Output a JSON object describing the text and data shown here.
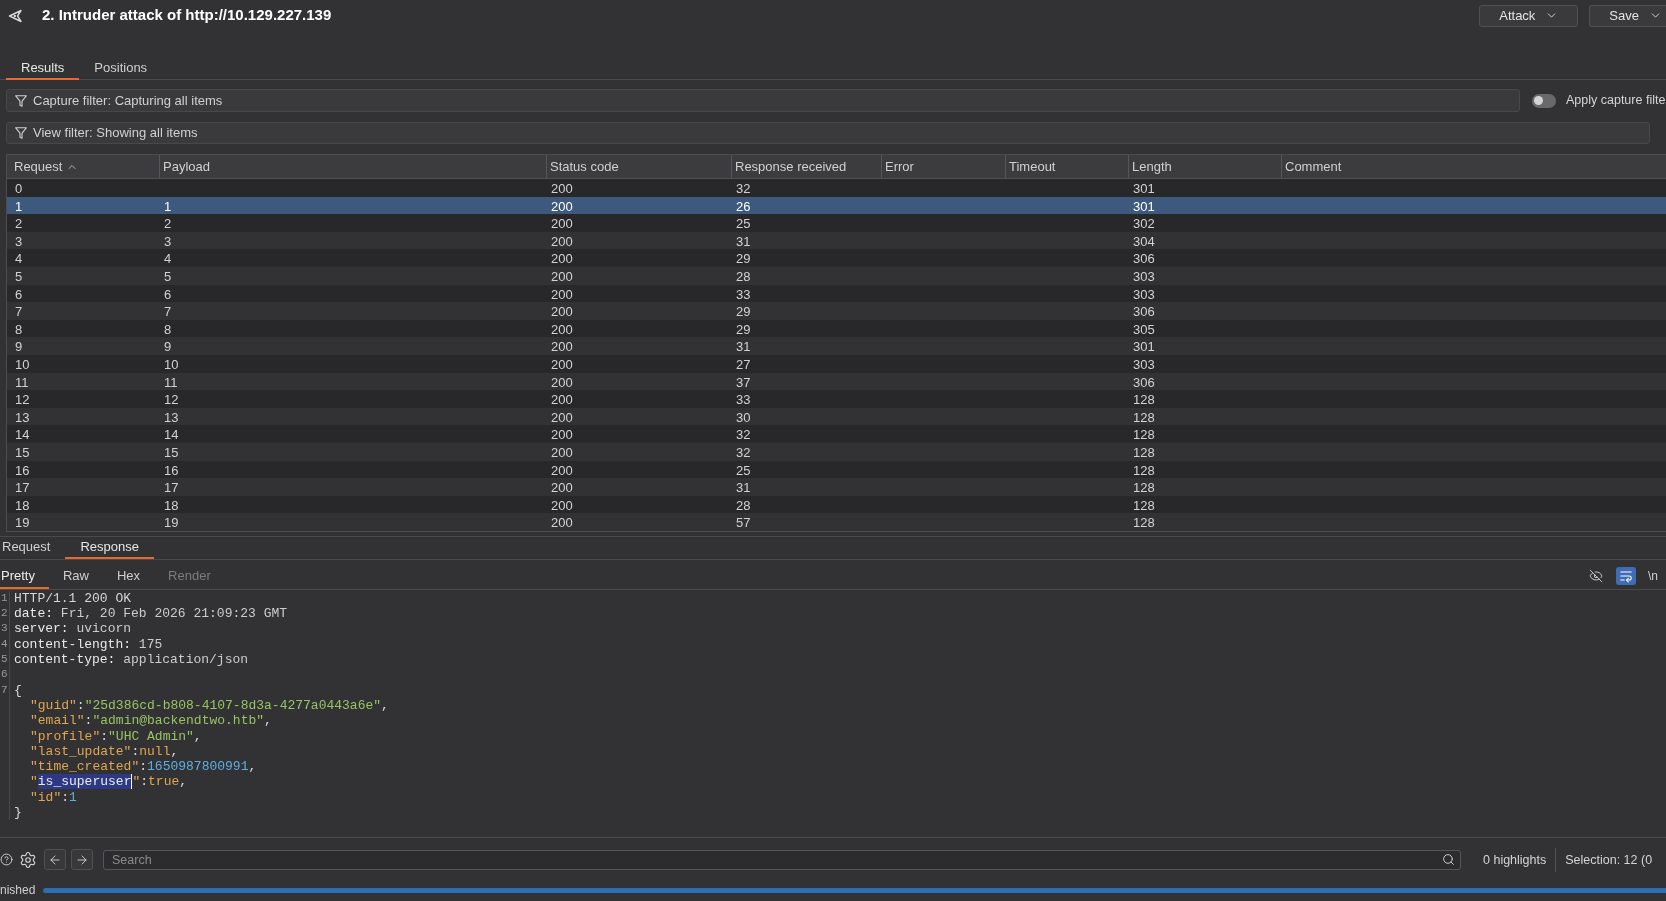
{
  "header": {
    "title": "2. Intruder attack of http://10.129.227.139",
    "buttons": [
      {
        "label": "Attack"
      },
      {
        "label": "Save"
      }
    ]
  },
  "tabs": [
    {
      "label": "Results",
      "selected": true
    },
    {
      "label": "Positions",
      "selected": false
    }
  ],
  "capture_filter": {
    "label": "Capture filter: Capturing all items",
    "toggle": {
      "label": "Apply capture filte",
      "on": false
    }
  },
  "view_filter": {
    "label": "View filter: Showing all items"
  },
  "table": {
    "columns": [
      {
        "label": "Request",
        "sorted_ascending": true
      },
      {
        "label": "Payload",
        "sorted_ascending": false
      },
      {
        "label": "Status code",
        "sorted_ascending": false
      },
      {
        "label": "Response received",
        "sorted_ascending": false
      },
      {
        "label": "Error",
        "sorted_ascending": false
      },
      {
        "label": "Timeout",
        "sorted_ascending": false
      },
      {
        "label": "Length",
        "sorted_ascending": false
      },
      {
        "label": "Comment",
        "sorted_ascending": false
      }
    ],
    "rows": [
      {
        "request": "0",
        "status_code": "200",
        "response_received": "32",
        "length": "301",
        "selected": false
      },
      {
        "request": "1",
        "payload": "1",
        "status_code": "200",
        "response_received": "26",
        "length": "301",
        "selected": true
      },
      {
        "request": "2",
        "payload": "2",
        "status_code": "200",
        "response_received": "25",
        "length": "302",
        "selected": false
      },
      {
        "request": "3",
        "payload": "3",
        "status_code": "200",
        "response_received": "31",
        "length": "304",
        "selected": false
      },
      {
        "request": "4",
        "payload": "4",
        "status_code": "200",
        "response_received": "29",
        "length": "306",
        "selected": false
      },
      {
        "request": "5",
        "payload": "5",
        "status_code": "200",
        "response_received": "28",
        "length": "303",
        "selected": false
      },
      {
        "request": "6",
        "payload": "6",
        "status_code": "200",
        "response_received": "33",
        "length": "303",
        "selected": false
      },
      {
        "request": "7",
        "payload": "7",
        "status_code": "200",
        "response_received": "29",
        "length": "306",
        "selected": false
      },
      {
        "request": "8",
        "payload": "8",
        "status_code": "200",
        "response_received": "29",
        "length": "305",
        "selected": false
      },
      {
        "request": "9",
        "payload": "9",
        "status_code": "200",
        "response_received": "31",
        "length": "301",
        "selected": false
      },
      {
        "request": "10",
        "payload": "10",
        "status_code": "200",
        "response_received": "27",
        "length": "303",
        "selected": false
      },
      {
        "request": "11",
        "payload": "11",
        "status_code": "200",
        "response_received": "37",
        "length": "306",
        "selected": false
      },
      {
        "request": "12",
        "payload": "12",
        "status_code": "200",
        "response_received": "33",
        "length": "128",
        "selected": false
      },
      {
        "request": "13",
        "payload": "13",
        "status_code": "200",
        "response_received": "30",
        "length": "128",
        "selected": false
      },
      {
        "request": "14",
        "payload": "14",
        "status_code": "200",
        "response_received": "32",
        "length": "128",
        "selected": false
      },
      {
        "request": "15",
        "payload": "15",
        "status_code": "200",
        "response_received": "32",
        "length": "128",
        "selected": false
      },
      {
        "request": "16",
        "payload": "16",
        "status_code": "200",
        "response_received": "25",
        "length": "128",
        "selected": false
      },
      {
        "request": "17",
        "payload": "17",
        "status_code": "200",
        "response_received": "31",
        "length": "128",
        "selected": false
      },
      {
        "request": "18",
        "payload": "18",
        "status_code": "200",
        "response_received": "28",
        "length": "128",
        "selected": false
      },
      {
        "request": "19",
        "payload": "19",
        "status_code": "200",
        "response_received": "57",
        "length": "128",
        "selected": false
      }
    ]
  },
  "message_tabs": [
    {
      "label": "Request",
      "selected": false
    },
    {
      "label": "Response",
      "selected": true
    }
  ],
  "view_tabs": [
    {
      "label": "Pretty",
      "selected": true,
      "disabled": false
    },
    {
      "label": "Raw",
      "selected": false,
      "disabled": false
    },
    {
      "label": "Hex",
      "selected": false,
      "disabled": false
    },
    {
      "label": "Render",
      "selected": false,
      "disabled": true
    }
  ],
  "view_tools": [
    {
      "kind": "hide",
      "on": false
    },
    {
      "kind": "wrap",
      "on": true
    },
    {
      "kind": "newline",
      "label": "\\n",
      "on": false
    }
  ],
  "code_lines": [
    {
      "number": "1",
      "tokens": [
        {
          "text": "HTTP/1.1 200 OK",
          "kind": "plain"
        }
      ]
    },
    {
      "number": "2",
      "tokens": [
        {
          "text": "date:",
          "kind": "header_name"
        },
        {
          "text": "Fri, 20 Feb 2026 21:09:23 GMT",
          "kind": "header_value"
        }
      ]
    },
    {
      "number": "3",
      "tokens": [
        {
          "text": "server:",
          "kind": "header_name"
        },
        {
          "text": "uvicorn",
          "kind": "header_value"
        }
      ]
    },
    {
      "number": "4",
      "tokens": [
        {
          "text": "content-length:",
          "kind": "header_name"
        },
        {
          "text": "175",
          "kind": "header_value"
        }
      ]
    },
    {
      "number": "5",
      "tokens": [
        {
          "text": "content-type:",
          "kind": "header_name"
        },
        {
          "text": "application/json",
          "kind": "header_value"
        }
      ]
    },
    {
      "number": "6"
    },
    {
      "number": "7",
      "tokens": [
        {
          "text": "{",
          "kind": "punct"
        }
      ],
      "children": [
        {
          "tokens": [
            {
              "text": "\"guid\"",
              "kind": "key"
            },
            {
              "text": ":",
              "kind": "punct"
            },
            {
              "text": "\"25d386cd-b808-4107-8d3a-4277a0443a6e\"",
              "kind": "string"
            },
            {
              "text": ",",
              "kind": "punct"
            }
          ]
        },
        {
          "tokens": [
            {
              "text": "\"email\"",
              "kind": "key"
            },
            {
              "text": ":",
              "kind": "punct"
            },
            {
              "text": "\"admin@backendtwo.htb\"",
              "kind": "string"
            },
            {
              "text": ",",
              "kind": "punct"
            }
          ]
        },
        {
          "tokens": [
            {
              "text": "\"profile\"",
              "kind": "key"
            },
            {
              "text": ":",
              "kind": "punct"
            },
            {
              "text": "\"UHC Admin\"",
              "kind": "string"
            },
            {
              "text": ",",
              "kind": "punct"
            }
          ]
        },
        {
          "tokens": [
            {
              "text": "\"last_update\"",
              "kind": "key"
            },
            {
              "text": ":",
              "kind": "punct"
            },
            {
              "text": "null",
              "kind": "literal"
            },
            {
              "text": ",",
              "kind": "punct"
            }
          ]
        },
        {
          "tokens": [
            {
              "text": "\"time_created\"",
              "kind": "key"
            },
            {
              "text": ":",
              "kind": "punct"
            },
            {
              "text": "1650987800991",
              "kind": "number"
            },
            {
              "text": ",",
              "kind": "punct"
            }
          ]
        },
        {
          "tokens": [
            {
              "text": "\"",
              "kind": "key"
            },
            {
              "text": "is_superuser",
              "kind": "selection"
            },
            {
              "text": "\"",
              "kind": "key"
            },
            {
              "text": ":",
              "kind": "punct"
            },
            {
              "text": "true",
              "kind": "literal"
            },
            {
              "text": ",",
              "kind": "punct"
            }
          ]
        },
        {
          "tokens": [
            {
              "text": "\"id\"",
              "kind": "key"
            },
            {
              "text": ":",
              "kind": "punct"
            },
            {
              "text": "1",
              "kind": "number"
            }
          ]
        }
      ],
      "close": [
        {
          "text": "}",
          "kind": "punct"
        }
      ]
    }
  ],
  "search": {
    "placeholder": "Search"
  },
  "highlights": "0 highlights",
  "selection": "Selection: 12 (0",
  "status": {
    "text": "nished",
    "level": 1
  }
}
